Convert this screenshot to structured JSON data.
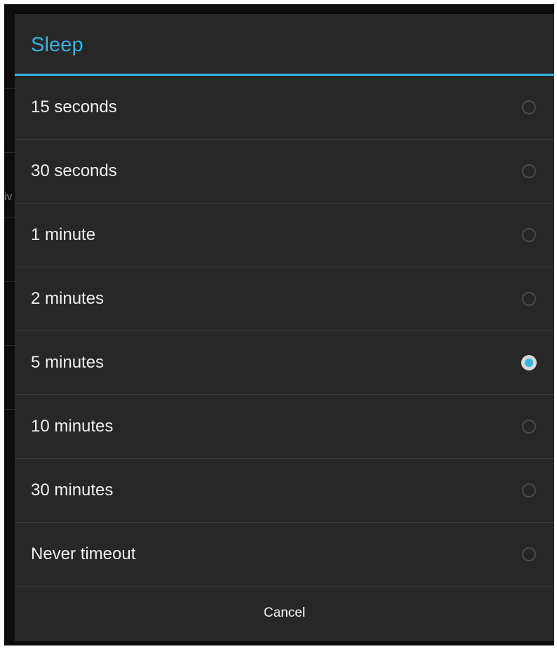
{
  "background": {
    "partial_label": "iv"
  },
  "dialog": {
    "title": "Sleep",
    "options": [
      {
        "label": "15 seconds",
        "selected": false
      },
      {
        "label": "30 seconds",
        "selected": false
      },
      {
        "label": "1 minute",
        "selected": false
      },
      {
        "label": "2 minutes",
        "selected": false
      },
      {
        "label": "5 minutes",
        "selected": true
      },
      {
        "label": "10 minutes",
        "selected": false
      },
      {
        "label": "30 minutes",
        "selected": false
      },
      {
        "label": "Never timeout",
        "selected": false
      }
    ],
    "cancel_label": "Cancel"
  },
  "colors": {
    "accent": "#33b5e5",
    "dialog_background": "#272727",
    "text": "#efefef",
    "divider": "#3c3c3c"
  },
  "icons": {
    "radio": "radio-button-icon"
  }
}
